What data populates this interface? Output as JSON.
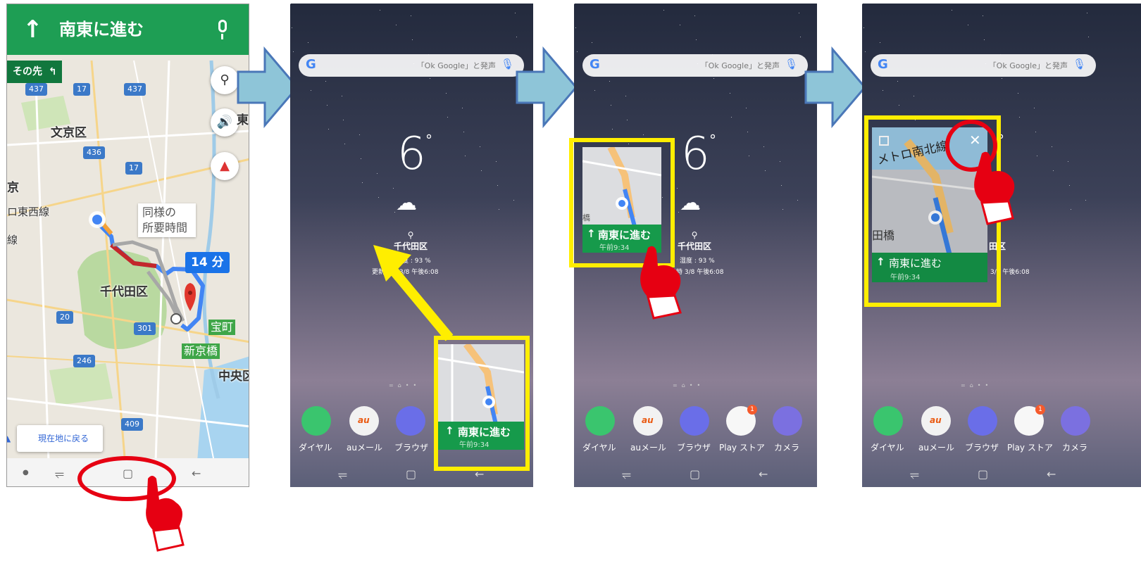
{
  "maps_screen": {
    "nav_title": "南東に進む",
    "then_label": "その先",
    "labels": {
      "bunkyo": "文京区",
      "chiyoda": "千代田区",
      "kyo": "京",
      "tozai": "ロ東西線",
      "sen": "線",
      "east": "東",
      "chuo": "中央区"
    },
    "similar_time": [
      "同様の",
      "所要時間"
    ],
    "eta": "14 分",
    "stations": [
      "宝町",
      "新京橋"
    ],
    "highways": [
      "437",
      "17",
      "437",
      "436",
      "17",
      "20",
      "301",
      "246",
      "409"
    ],
    "recenter_label": "現在地に戻る"
  },
  "home": {
    "search_hint": "「Ok Google」と発声",
    "temperature": "6",
    "degree": "°",
    "location": "千代田区",
    "humidity": "湿度 : 93 %",
    "updated": "更新日時 3/8 午後6:08",
    "updated_short": "日時 3/8 午後6:08",
    "updated_crop": "3/8 午後6:08",
    "apps": [
      "ダイヤル",
      "auメール",
      "ブラウザ",
      "Play ストア",
      "カメラ"
    ],
    "app_label_crop": "Pl",
    "play_badge": "1",
    "au_mark": "au"
  },
  "mini_nav": {
    "title": "南東に進む",
    "time": "午前9:34",
    "metro_label": "メトロ南北線",
    "station_crop": "田橋",
    "station_crop_small": "橋",
    "weather_crop_right": "田区"
  },
  "colors": {
    "nav_green": "#1e9e54",
    "highlight": "#ffee00",
    "step_arrow": "#8ec5d8",
    "tap_red": "#e60012"
  }
}
